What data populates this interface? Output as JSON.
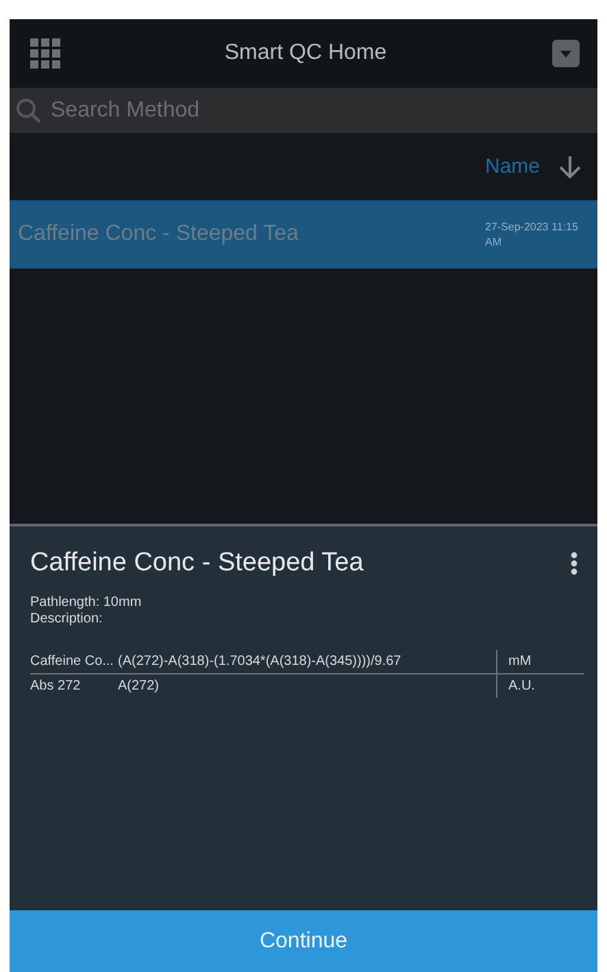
{
  "app_bar": {
    "title": "Smart QC Home"
  },
  "search": {
    "placeholder": "Search Method"
  },
  "sort": {
    "label": "Name"
  },
  "methods": [
    {
      "name": "Caffeine Conc - Steeped Tea",
      "date": "27-Sep-2023 11:15 AM",
      "selected": true
    }
  ],
  "detail": {
    "title": "Caffeine Conc - Steeped Tea",
    "pathlength": "Pathlength: 10mm",
    "description": "Description:",
    "results": [
      {
        "name": "Caffeine Co...",
        "formula": "(A(272)-A(318)-(1.7034*(A(318)-A(345))))/9.67",
        "unit": "mM"
      },
      {
        "name": "Abs 272",
        "formula": "A(272)",
        "unit": "A.U."
      }
    ]
  },
  "continue_button": "Continue"
}
